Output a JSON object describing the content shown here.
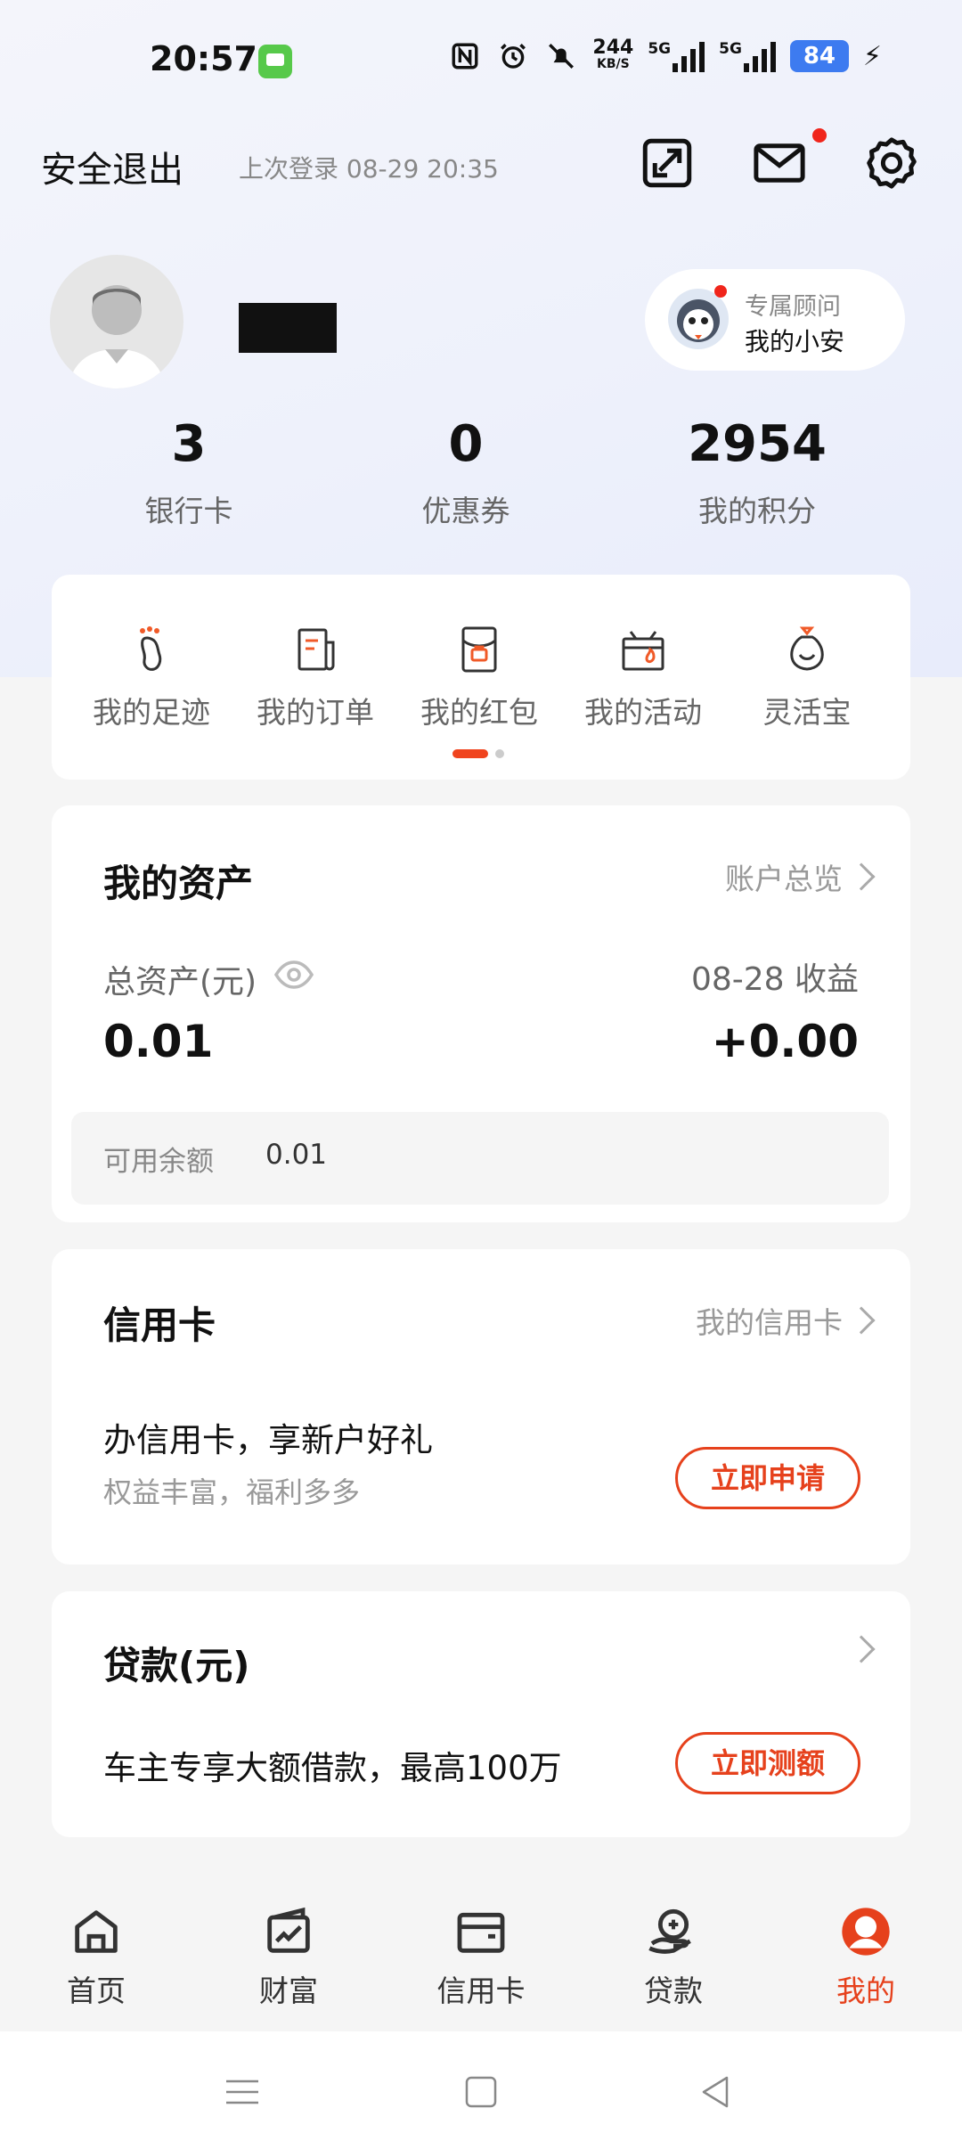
{
  "status_bar": {
    "time": "20:57",
    "net_speed": "244",
    "net_unit": "KB/S",
    "sim1": "5G",
    "sim2": "5G",
    "battery": "84"
  },
  "header": {
    "logout_label": "安全退出",
    "last_login": "上次登录 08-29 20:35",
    "icons": [
      "share-icon",
      "mail-icon",
      "gear-icon"
    ]
  },
  "profile": {
    "advisor_title": "专属顾问",
    "advisor_name": "我的小安"
  },
  "stats": [
    {
      "value": "3",
      "label": "银行卡"
    },
    {
      "value": "0",
      "label": "优惠券"
    },
    {
      "value": "2954",
      "label": "我的积分"
    }
  ],
  "quick_menu": [
    {
      "label": "我的足迹",
      "icon": "footprint-icon"
    },
    {
      "label": "我的订单",
      "icon": "order-icon"
    },
    {
      "label": "我的红包",
      "icon": "red-packet-icon"
    },
    {
      "label": "我的活动",
      "icon": "activity-icon"
    },
    {
      "label": "灵活宝",
      "icon": "money-bag-icon"
    }
  ],
  "assets": {
    "title": "我的资产",
    "overview_link": "账户总览",
    "total_label": "总资产(元)",
    "total_value": "0.01",
    "earnings_label": "08-28 收益",
    "earnings_value": "+0.00",
    "balance_label": "可用余额",
    "balance_value": "0.01"
  },
  "credit_card": {
    "title": "信用卡",
    "link": "我的信用卡",
    "headline": "办信用卡，享新户好礼",
    "subline": "权益丰富，福利多多",
    "button": "立即申请"
  },
  "loan": {
    "title": "贷款(元)",
    "headline": "车主专享大额借款，最高100万",
    "button": "立即测额"
  },
  "bottom_nav": [
    {
      "label": "首页",
      "icon": "home-icon"
    },
    {
      "label": "财富",
      "icon": "wealth-icon"
    },
    {
      "label": "信用卡",
      "icon": "card-icon"
    },
    {
      "label": "贷款",
      "icon": "loan-icon"
    },
    {
      "label": "我的",
      "icon": "profile-icon",
      "active": true
    }
  ],
  "colors": {
    "accent": "#e6411c",
    "notification_dot": "#f0251b"
  }
}
